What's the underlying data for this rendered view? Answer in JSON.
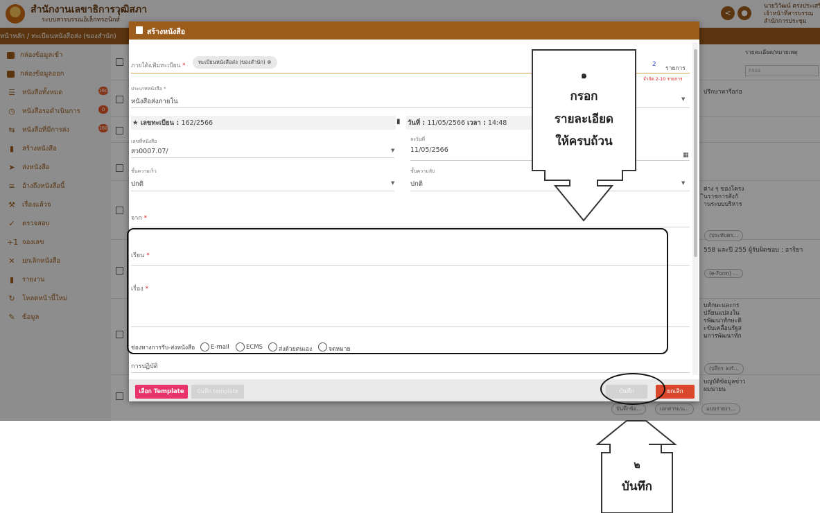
{
  "header": {
    "org_title": "สำนักงานเลขาธิการวุฒิสภา",
    "org_sub": "ระบบสารบรรณอิเล็กทรอนิกส์",
    "user_line1": "นายวิวัฒน์ ตรงประเสริฐ",
    "user_line2": "เจ้าหน้าที่สารบรรณ",
    "user_line3": "สำนักการประชุม"
  },
  "breadcrumb": "หน้าหลัก / ทะเบียนหนังสือส่ง (ของสำนัก)",
  "sidebar": {
    "items": [
      {
        "label": "กล่องข้อมูลเข้า"
      },
      {
        "label": "กล่องข้อมูลออก"
      },
      {
        "label": "หนังสือทั้งหมด",
        "badge": "160"
      },
      {
        "label": "หนังสือรอดำเนินการ",
        "badge": "0"
      },
      {
        "label": "หนังสือที่มีการส่ง",
        "badge": "160"
      },
      {
        "label": "สร้างหนังสือ"
      },
      {
        "label": "ส่งหนังสือ"
      },
      {
        "label": "อ้างถึงหนังสือนี้"
      },
      {
        "label": "เรื่องแล้วจ"
      },
      {
        "label": "ตรวจสอบ"
      },
      {
        "label": "จองเลข"
      },
      {
        "label": "ยกเลิกหนังสือ"
      },
      {
        "label": "รายงาน"
      },
      {
        "label": "โหลดหน้านี้ใหม่"
      },
      {
        "label": "ข้อมูล"
      }
    ]
  },
  "background": {
    "col_header": "รายละเอียด/หมายเหตุ",
    "filter_placeholder": "กรอง",
    "snippets": [
      "ปรึกษาหารือก่อ",
      "ต่าง ๆ ของโครง",
      "ินราชการสังกั",
      "านระบบบริหาร",
      "558 และปี 255 ผู้รับผิดชอบ : อาริยา",
      "บทักษะและกร",
      "ปลี่ยนแปลงใน",
      "รพัฒนาทักษะดิ",
      "ะขับเคลื่อนรัฐส",
      "มการพัฒนาทัก",
      "บญบัติข้อมูลข่าว",
      "ผมนายน"
    ],
    "pills": [
      "(ประทับตร...",
      "(e-Form) ...",
      "(ปลึกร ลงรั...",
      "บันทึกข้อ...",
      "เอกสารแน...",
      "แบบรายงา..."
    ]
  },
  "modal": {
    "title": "สร้างหนังสือ",
    "register_label": "ภายใต้แฟ้มทะเบียน",
    "register_chip": "ทะเบียนหนังสือส่ง (ของสำนัก)",
    "items_count": "2",
    "items_label": "รายการ",
    "items_hint": "จำกัด 2-10 รายการ",
    "doc_type_label": "ประเภทหนังสือ *",
    "doc_type_value": "หนังสือส่งภายใน",
    "reg_no_label": "เลขทะเบียน :",
    "reg_no_value": "162/2566",
    "date_label": "วันที่ :",
    "date_value": "11/05/2566",
    "time_label": "เวลา :",
    "time_value": "14:48",
    "doc_no_label": "เลขที่หนังสือ",
    "doc_no_value": "สว0007.07/",
    "dated_label": "ลงวันที่",
    "dated_value": "11/05/2566",
    "urgency_label": "ชั้นความเร็ว",
    "urgency_value": "ปกติ",
    "secrecy_label": "ชั้นความลับ",
    "secrecy_value": "ปกติ",
    "from_label": "จาก",
    "to_label": "เรียน",
    "subject_label": "เรื่อง",
    "channel_label": "ช่องทางการรับ-ส่งหนังสือ",
    "channels": [
      "E-mail",
      "ECMS",
      "ส่งด้วยตนเอง",
      "จดหมาย"
    ],
    "action_label": "การปฏิบัติ",
    "btn_template": "เลือก Template",
    "btn_save_template": "บันทึก template",
    "btn_save": "บันทึก",
    "btn_cancel": "ยกเลิก"
  },
  "callouts": {
    "step1_number": "๑",
    "step1_line1": "กรอก",
    "step1_line2": "รายละเอียด",
    "step1_line3": "ให้ครบถ้วน",
    "step2_number": "๒",
    "step2_line1": "บันทึก"
  }
}
